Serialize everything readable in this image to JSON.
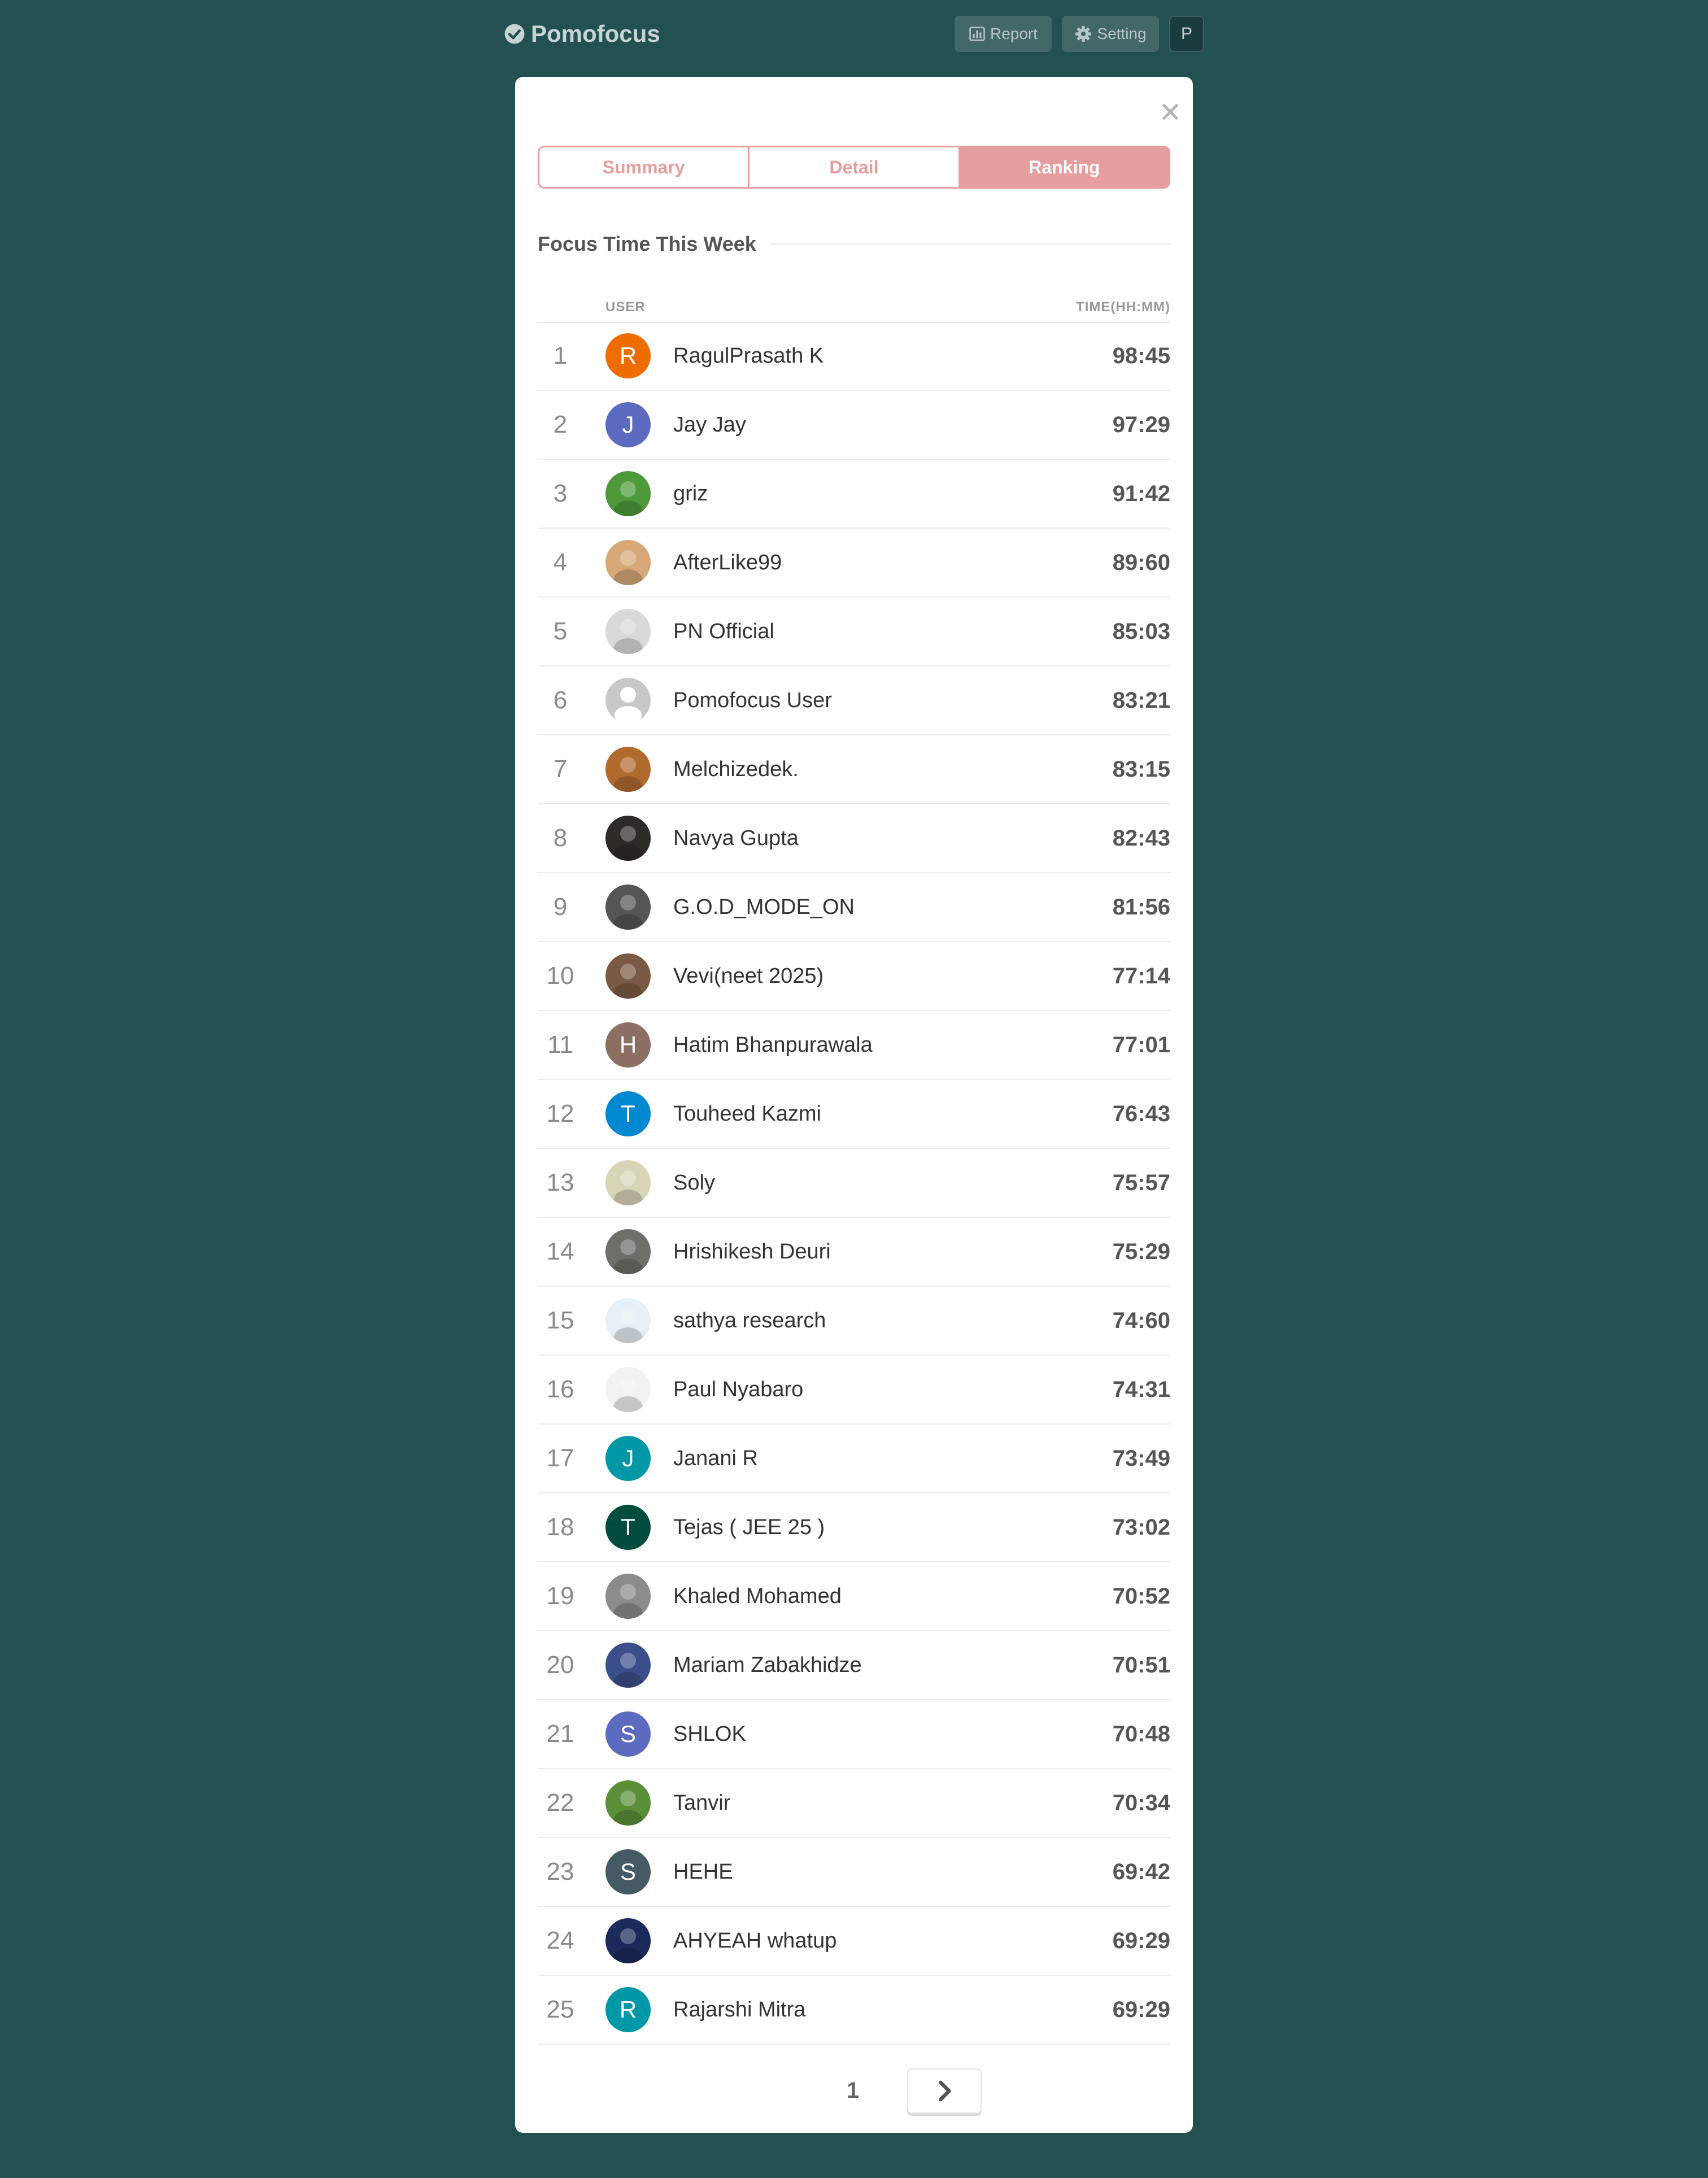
{
  "header": {
    "brand": "Pomofocus",
    "report_label": "Report",
    "setting_label": "Setting",
    "profile_initial": "P"
  },
  "modal": {
    "tabs": [
      {
        "label": "Summary",
        "active": false
      },
      {
        "label": "Detail",
        "active": false
      },
      {
        "label": "Ranking",
        "active": true
      }
    ],
    "section_title": "Focus Time This Week",
    "columns": {
      "user": "USER",
      "time": "TIME(HH:MM)"
    },
    "rows": [
      {
        "rank": "1",
        "name": "RagulPrasath K",
        "time": "98:45",
        "avatar": {
          "type": "initial",
          "letter": "R",
          "color": "#ef6c00"
        }
      },
      {
        "rank": "2",
        "name": "Jay Jay",
        "time": "97:29",
        "avatar": {
          "type": "initial",
          "letter": "J",
          "color": "#5c6bc0"
        }
      },
      {
        "rank": "3",
        "name": "griz",
        "time": "91:42",
        "avatar": {
          "type": "photo",
          "color": "#4e9a3a"
        }
      },
      {
        "rank": "4",
        "name": "AfterLike99",
        "time": "89:60",
        "avatar": {
          "type": "photo",
          "color": "#d6a877"
        }
      },
      {
        "rank": "5",
        "name": "PN Official",
        "time": "85:03",
        "avatar": {
          "type": "photo",
          "color": "#d9d9d9"
        }
      },
      {
        "rank": "6",
        "name": "Pomofocus User",
        "time": "83:21",
        "avatar": {
          "type": "default",
          "color": "#c8c8c8"
        }
      },
      {
        "rank": "7",
        "name": "Melchizedek.",
        "time": "83:15",
        "avatar": {
          "type": "photo",
          "color": "#b06a2e"
        }
      },
      {
        "rank": "8",
        "name": "Navya Gupta",
        "time": "82:43",
        "avatar": {
          "type": "photo",
          "color": "#2e2a26"
        }
      },
      {
        "rank": "9",
        "name": "G.O.D_MODE_ON",
        "time": "81:56",
        "avatar": {
          "type": "photo",
          "color": "#555555"
        }
      },
      {
        "rank": "10",
        "name": "Vevi(neet 2025)",
        "time": "77:14",
        "avatar": {
          "type": "photo",
          "color": "#7a5a44"
        }
      },
      {
        "rank": "11",
        "name": "Hatim Bhanpurawala",
        "time": "77:01",
        "avatar": {
          "type": "initial",
          "letter": "H",
          "color": "#8d6e63"
        }
      },
      {
        "rank": "12",
        "name": "Touheed Kazmi",
        "time": "76:43",
        "avatar": {
          "type": "initial",
          "letter": "T",
          "color": "#0288d1"
        }
      },
      {
        "rank": "13",
        "name": "Soly",
        "time": "75:57",
        "avatar": {
          "type": "photo",
          "color": "#d8d4b8"
        }
      },
      {
        "rank": "14",
        "name": "Hrishikesh Deuri",
        "time": "75:29",
        "avatar": {
          "type": "photo",
          "color": "#6d6f68"
        }
      },
      {
        "rank": "15",
        "name": "sathya research",
        "time": "74:60",
        "avatar": {
          "type": "photo",
          "color": "#e6f0f6"
        }
      },
      {
        "rank": "16",
        "name": "Paul Nyabaro",
        "time": "74:31",
        "avatar": {
          "type": "photo",
          "color": "#f2f2f2"
        }
      },
      {
        "rank": "17",
        "name": "Janani R",
        "time": "73:49",
        "avatar": {
          "type": "initial",
          "letter": "J",
          "color": "#0097a7"
        }
      },
      {
        "rank": "18",
        "name": "Tejas ( JEE 25 )",
        "time": "73:02",
        "avatar": {
          "type": "initial",
          "letter": "T",
          "color": "#004d40"
        }
      },
      {
        "rank": "19",
        "name": "Khaled Mohamed",
        "time": "70:52",
        "avatar": {
          "type": "photo",
          "color": "#8c8c8c"
        }
      },
      {
        "rank": "20",
        "name": "Mariam Zabakhidze",
        "time": "70:51",
        "avatar": {
          "type": "photo",
          "color": "#3a4f8a"
        }
      },
      {
        "rank": "21",
        "name": "SHLOK",
        "time": "70:48",
        "avatar": {
          "type": "initial",
          "letter": "S",
          "color": "#5c6bc0"
        }
      },
      {
        "rank": "22",
        "name": "Tanvir",
        "time": "70:34",
        "avatar": {
          "type": "photo",
          "color": "#5a8f3a"
        }
      },
      {
        "rank": "23",
        "name": "HEHE",
        "time": "69:42",
        "avatar": {
          "type": "initial",
          "letter": "S",
          "color": "#455a64"
        }
      },
      {
        "rank": "24",
        "name": "AHYEAH whatup",
        "time": "69:29",
        "avatar": {
          "type": "photo",
          "color": "#1a2a5a"
        }
      },
      {
        "rank": "25",
        "name": "Rajarshi Mitra",
        "time": "69:29",
        "avatar": {
          "type": "initial",
          "letter": "R",
          "color": "#0097a7"
        }
      }
    ],
    "pagination": {
      "current_page": "1"
    }
  },
  "colors": {
    "background": "#235050",
    "accent": "#e59d9d",
    "text_dark": "#333333",
    "text_muted": "#8a8a8a"
  }
}
